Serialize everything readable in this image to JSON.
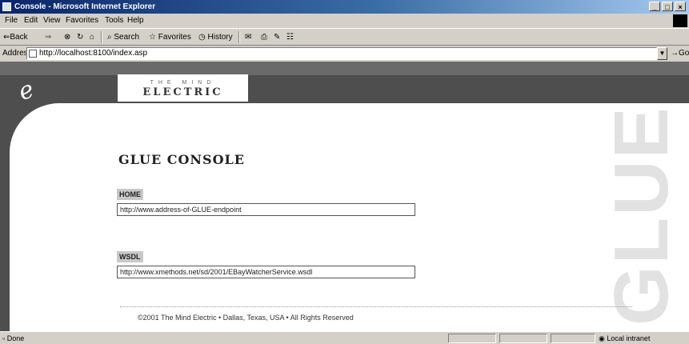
{
  "window": {
    "title": "Console - Microsoft Internet Explorer",
    "controls": [
      "_",
      "□",
      "×"
    ]
  },
  "menu": [
    "File",
    "Edit",
    "View",
    "Favorites",
    "Tools",
    "Help"
  ],
  "toolbar": {
    "back": "⇐Back",
    "forward": "⇒",
    "stop": "⊗",
    "refresh": "↻",
    "home": "⌂",
    "search": "Search",
    "favorites": "Favorites",
    "history": "History",
    "mail": "✉",
    "print": "⎙",
    "edit": "✎",
    "discuss": "☷"
  },
  "address": {
    "label": "Address",
    "url": "http://localhost:8100/index.asp",
    "go": "Go"
  },
  "page": {
    "logo_top": "THE MIND",
    "logo_bottom": "ELECTRIC",
    "logo_mark": "e",
    "watermark": "GLUE",
    "title": "GLUE CONSOLE",
    "home_label": "HOME",
    "home_value": "http://www.address-of-GLUE-endpoint",
    "wsdl_label": "WSDL",
    "wsdl_value": "http://www.xmethods.net/sd/2001/EBayWatcherService.wsdl",
    "footer": "©2001 The Mind Electric • Dallas, Texas, USA • All Rights Reserved"
  },
  "status": {
    "text": "Done",
    "zone": "Local intranet"
  }
}
